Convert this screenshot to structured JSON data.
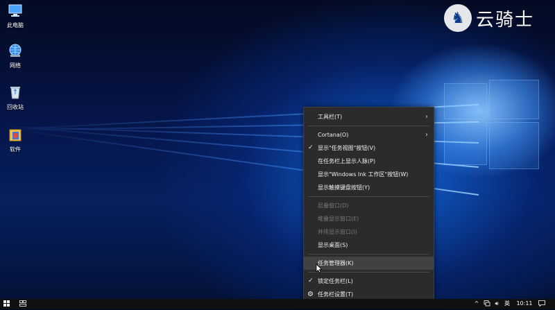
{
  "desktop": {
    "icons": [
      {
        "label": "此电脑",
        "icon": "computer-icon"
      },
      {
        "label": "网络",
        "icon": "network-icon"
      },
      {
        "label": "回收站",
        "icon": "recycle-bin-icon"
      },
      {
        "label": "软件",
        "icon": "folder-icon"
      }
    ],
    "logo_text": "云骑士"
  },
  "context_menu": {
    "items": [
      {
        "label": "工具栏(T)",
        "submenu": true
      },
      {
        "label": "Cortana(O)",
        "submenu": true
      },
      {
        "label": "显示\"任务视图\"按钮(V)",
        "checked": true
      },
      {
        "label": "在任务栏上显示人脉(P)"
      },
      {
        "label": "显示\"Windows Ink 工作区\"按钮(W)"
      },
      {
        "label": "显示触摸键盘按钮(Y)"
      },
      {
        "label": "层叠窗口(D)",
        "disabled": true
      },
      {
        "label": "堆叠显示窗口(E)",
        "disabled": true
      },
      {
        "label": "并排显示窗口(I)",
        "disabled": true
      },
      {
        "label": "显示桌面(S)"
      },
      {
        "label": "任务管理器(K)",
        "hover": true
      },
      {
        "label": "锁定任务栏(L)",
        "checked": true
      },
      {
        "label": "任务栏设置(T)",
        "icon": "gear-icon"
      }
    ]
  },
  "taskbar": {
    "ime": "英",
    "time": "10:11",
    "tray_icons": [
      "chevron-up-icon",
      "network-icon",
      "volume-icon"
    ]
  }
}
